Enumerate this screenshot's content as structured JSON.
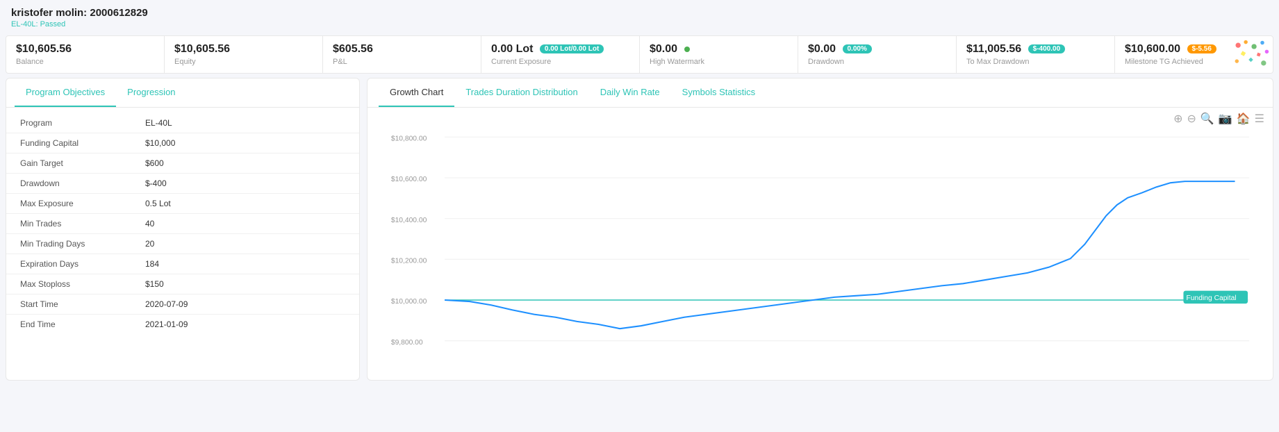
{
  "header": {
    "user": "kristofer molin: 2000612829",
    "status": "EL-40L: Passed"
  },
  "stats": [
    {
      "value": "$10,605.56",
      "label": "Balance",
      "badge": null
    },
    {
      "value": "$10,605.56",
      "label": "Equity",
      "badge": null
    },
    {
      "value": "$605.56",
      "label": "P&L",
      "badge": null
    },
    {
      "value": "0.00 Lot",
      "label": "Current Exposure",
      "badge": "0.00 Lot/0.00 Lot",
      "badgeType": "teal"
    },
    {
      "value": "$0.00",
      "label": "High Watermark",
      "badge": "green-dot"
    },
    {
      "value": "$0.00",
      "label": "Drawdown",
      "badge": "0.00%",
      "badgeType": "teal"
    },
    {
      "value": "$11,005.56",
      "label": "To Max Drawdown",
      "badge": "$-400.00",
      "badgeType": "teal"
    },
    {
      "value": "$10,600.00",
      "label": "Milestone TG Achieved",
      "badge": "$-5.56",
      "badgeType": "orange"
    }
  ],
  "leftPanel": {
    "tabs": [
      "Program Objectives",
      "Progression"
    ],
    "activeTab": 0,
    "rows": [
      {
        "label": "Program",
        "value": "EL-40L"
      },
      {
        "label": "Funding Capital",
        "value": "$10,000"
      },
      {
        "label": "Gain Target",
        "value": "$600"
      },
      {
        "label": "Drawdown",
        "value": "$-400"
      },
      {
        "label": "Max Exposure",
        "value": "0.5 Lot"
      },
      {
        "label": "Min Trades",
        "value": "40"
      },
      {
        "label": "Min Trading Days",
        "value": "20"
      },
      {
        "label": "Expiration Days",
        "value": "184"
      },
      {
        "label": "Max Stoploss",
        "value": "$150"
      },
      {
        "label": "Start Time",
        "value": "2020-07-09"
      },
      {
        "label": "End Time",
        "value": "2021-01-09"
      }
    ]
  },
  "rightPanel": {
    "tabs": [
      "Growth Chart",
      "Trades Duration Distribution",
      "Daily Win Rate",
      "Symbols Statistics"
    ],
    "activeTab": 0,
    "chart": {
      "yLabels": [
        "$10,800.00",
        "$10,600.00",
        "$10,400.00",
        "$10,200.00",
        "$10,000.00",
        "$9,800.00"
      ],
      "fundingLabel": "Funding Capital",
      "toolbarIcons": [
        "+",
        "−",
        "🔍",
        "📷",
        "🏠",
        "☰"
      ]
    }
  }
}
